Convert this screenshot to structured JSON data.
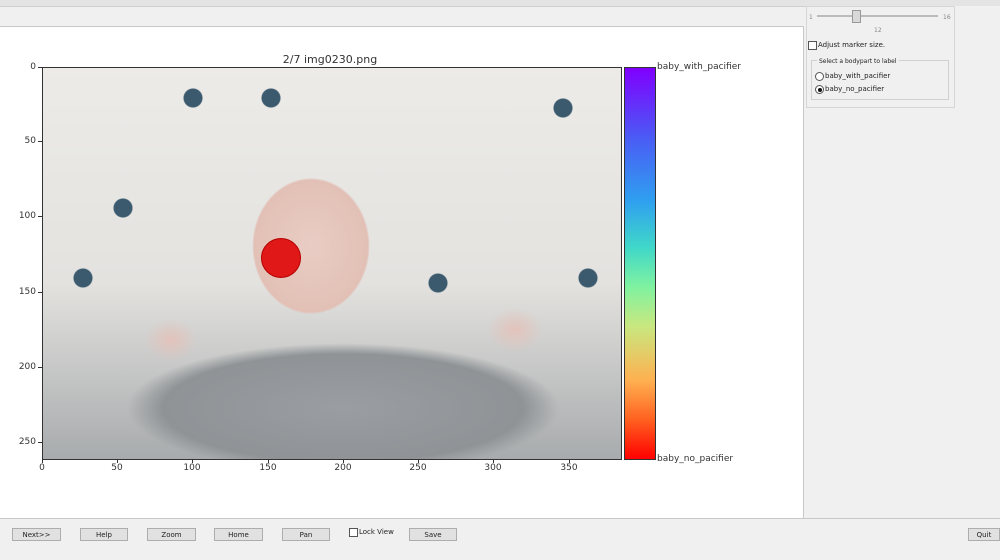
{
  "plot": {
    "title": "2/7 img0230.png",
    "y_ticks": [
      "0",
      "50",
      "100",
      "150",
      "200",
      "250"
    ],
    "x_ticks": [
      "0",
      "50",
      "100",
      "150",
      "200",
      "250",
      "300",
      "350"
    ],
    "colorbar_top_label": "baby_with_pacifier",
    "colorbar_bottom_label": "baby_no_pacifier"
  },
  "marker": {
    "color": "#e01818",
    "label": "baby_no_pacifier"
  },
  "side_panel": {
    "slider": {
      "min": "1",
      "max": "16",
      "value": "12"
    },
    "adjust_marker_size_label": "Adjust marker size.",
    "group_title": "Select a bodypart to label",
    "options": [
      {
        "label": "baby_with_pacifier",
        "selected": false
      },
      {
        "label": "baby_no_pacifier",
        "selected": true
      }
    ]
  },
  "toolbar": {
    "next_label": "Next>>",
    "help_label": "Help",
    "zoom_label": "Zoom",
    "home_label": "Home",
    "pan_label": "Pan",
    "lock_view_label": "Lock View",
    "save_label": "Save",
    "quit_label": "Quit"
  }
}
